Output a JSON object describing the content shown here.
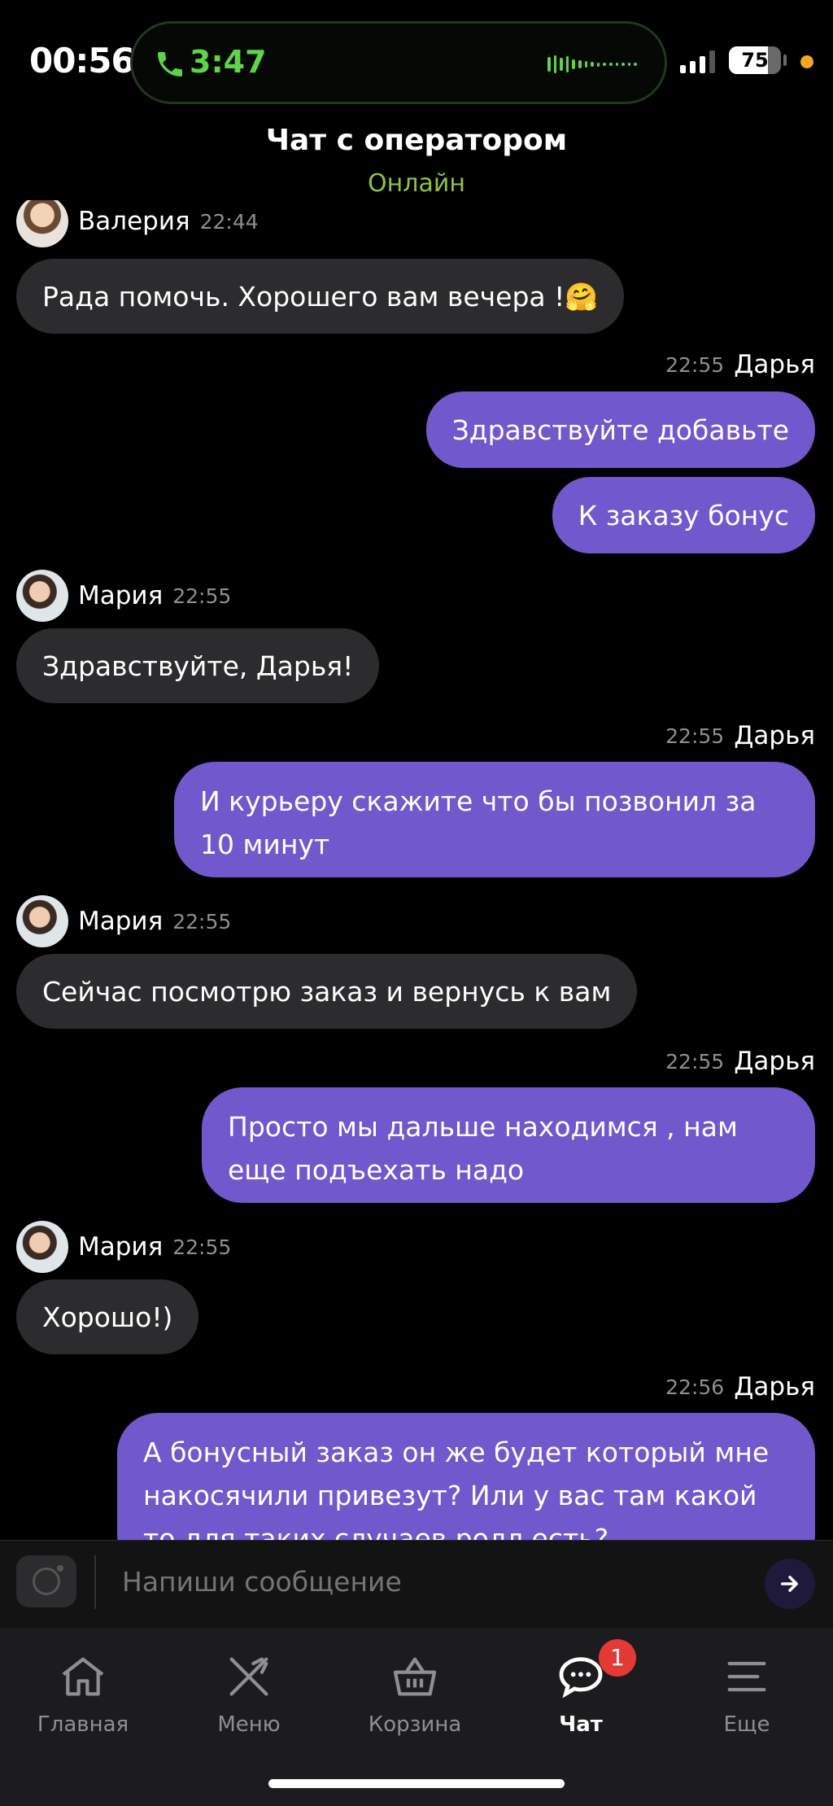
{
  "status_bar": {
    "time": "00:56",
    "call_duration": "3:47",
    "battery": "75",
    "battery_level_percent": 75
  },
  "header": {
    "title": "Чат с оператором",
    "status": "Онлайн"
  },
  "messages": {
    "m1": {
      "name": "Валерия",
      "time": "22:44",
      "text": "Рада помочь. Хорошего вам  вечера !🤗"
    },
    "m2": {
      "name": "Дарья",
      "time": "22:55",
      "text1": "Здравствуйте добавьте",
      "text2": "К заказу бонус"
    },
    "m3": {
      "name": "Мария",
      "time": "22:55",
      "text": "Здравствуйте, Дарья!"
    },
    "m4": {
      "name": "Дарья",
      "time": "22:55",
      "text": "И курьеру скажите что бы позвонил за 10 минут"
    },
    "m5": {
      "name": "Мария",
      "time": "22:55",
      "text": "Сейчас посмотрю заказ и вернусь к вам"
    },
    "m6": {
      "name": "Дарья",
      "time": "22:55",
      "text": "Просто мы дальше находимся , нам еще подъехать надо"
    },
    "m7": {
      "name": "Мария",
      "time": "22:55",
      "text": "Хорошо!)"
    },
    "m8": {
      "name": "Дарья",
      "time": "22:56",
      "text": "А бонусный заказ он же будет который мне накосячили привезут? Или у вас там какой то для таких случаев ролл есть?"
    }
  },
  "composer": {
    "placeholder": "Напиши сообщение"
  },
  "nav": {
    "home": "Главная",
    "menu": "Меню",
    "cart": "Корзина",
    "chat": "Чат",
    "chat_badge": "1",
    "more": "Еще"
  },
  "colors": {
    "accent": "#7158cc",
    "online": "#8bc34a",
    "call": "#5fd34a",
    "badge": "#e53935"
  }
}
